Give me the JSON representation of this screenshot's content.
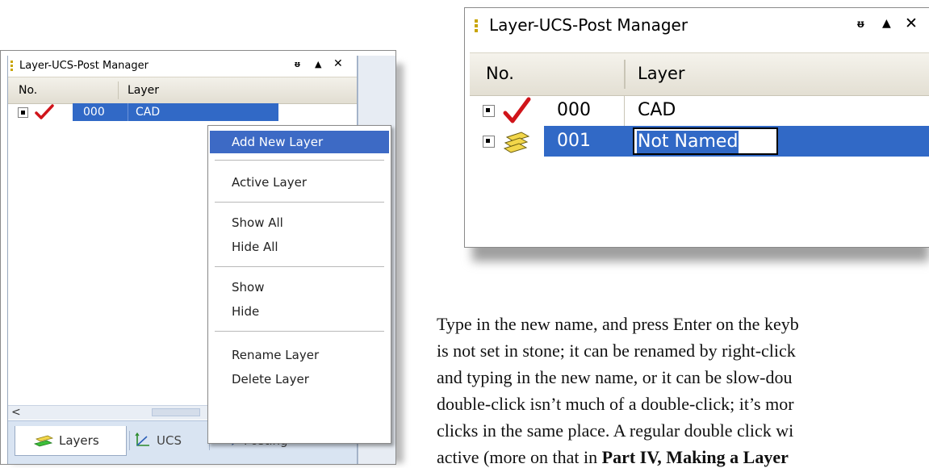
{
  "left_panel": {
    "title": "Layer-UCS-Post Manager",
    "pin_glyph": "ᵿ",
    "up_glyph": "▲",
    "close_glyph": "✕",
    "column_headers": {
      "no": "No.",
      "layer": "Layer"
    },
    "rows": [
      {
        "no": "000",
        "name": "CAD"
      }
    ],
    "scroll_left_glyph": "<",
    "tabs": [
      {
        "label": "Layers",
        "icon": "layers-icon",
        "selected": true
      },
      {
        "label": "UCS",
        "icon": "ucs-axes-icon",
        "selected": false
      },
      {
        "label": "Posting",
        "icon": "posting-icon",
        "selected": false
      }
    ]
  },
  "context_menu": {
    "items": [
      "Add New Layer",
      "Active Layer",
      "Show All",
      "Hide All",
      "Show",
      "Hide",
      "Rename Layer",
      "Delete Layer"
    ],
    "highlighted": "Add New Layer"
  },
  "right_panel": {
    "title": "Layer-UCS-Post Manager",
    "pin_glyph": "ᵿ",
    "up_glyph": "▲",
    "close_glyph": "✕",
    "column_headers": {
      "no": "No.",
      "layer": "Layer"
    },
    "rows": [
      {
        "no": "000",
        "name": "CAD",
        "icon": "check-icon"
      },
      {
        "no": "001",
        "name": "Not Named",
        "icon": "layers-icon",
        "editing": true
      }
    ]
  },
  "body_text": {
    "lines": [
      "Type in the new name, and press Enter on the keyb",
      "is not set in stone; it can be renamed by right-click",
      "and typing in the new name, or it can be slow-dou",
      "double-click isn’t much of a double-click; it’s mor",
      "clicks in the same place. A regular double click wi",
      "active (more on that in "
    ],
    "last_line_bold": "Part IV, Making a Layer"
  },
  "colors": {
    "selection": "#3169c6",
    "menu_highlight": "#3d6ac5",
    "grip": "#c8a400",
    "tab_bar": "#d9e4f2"
  }
}
